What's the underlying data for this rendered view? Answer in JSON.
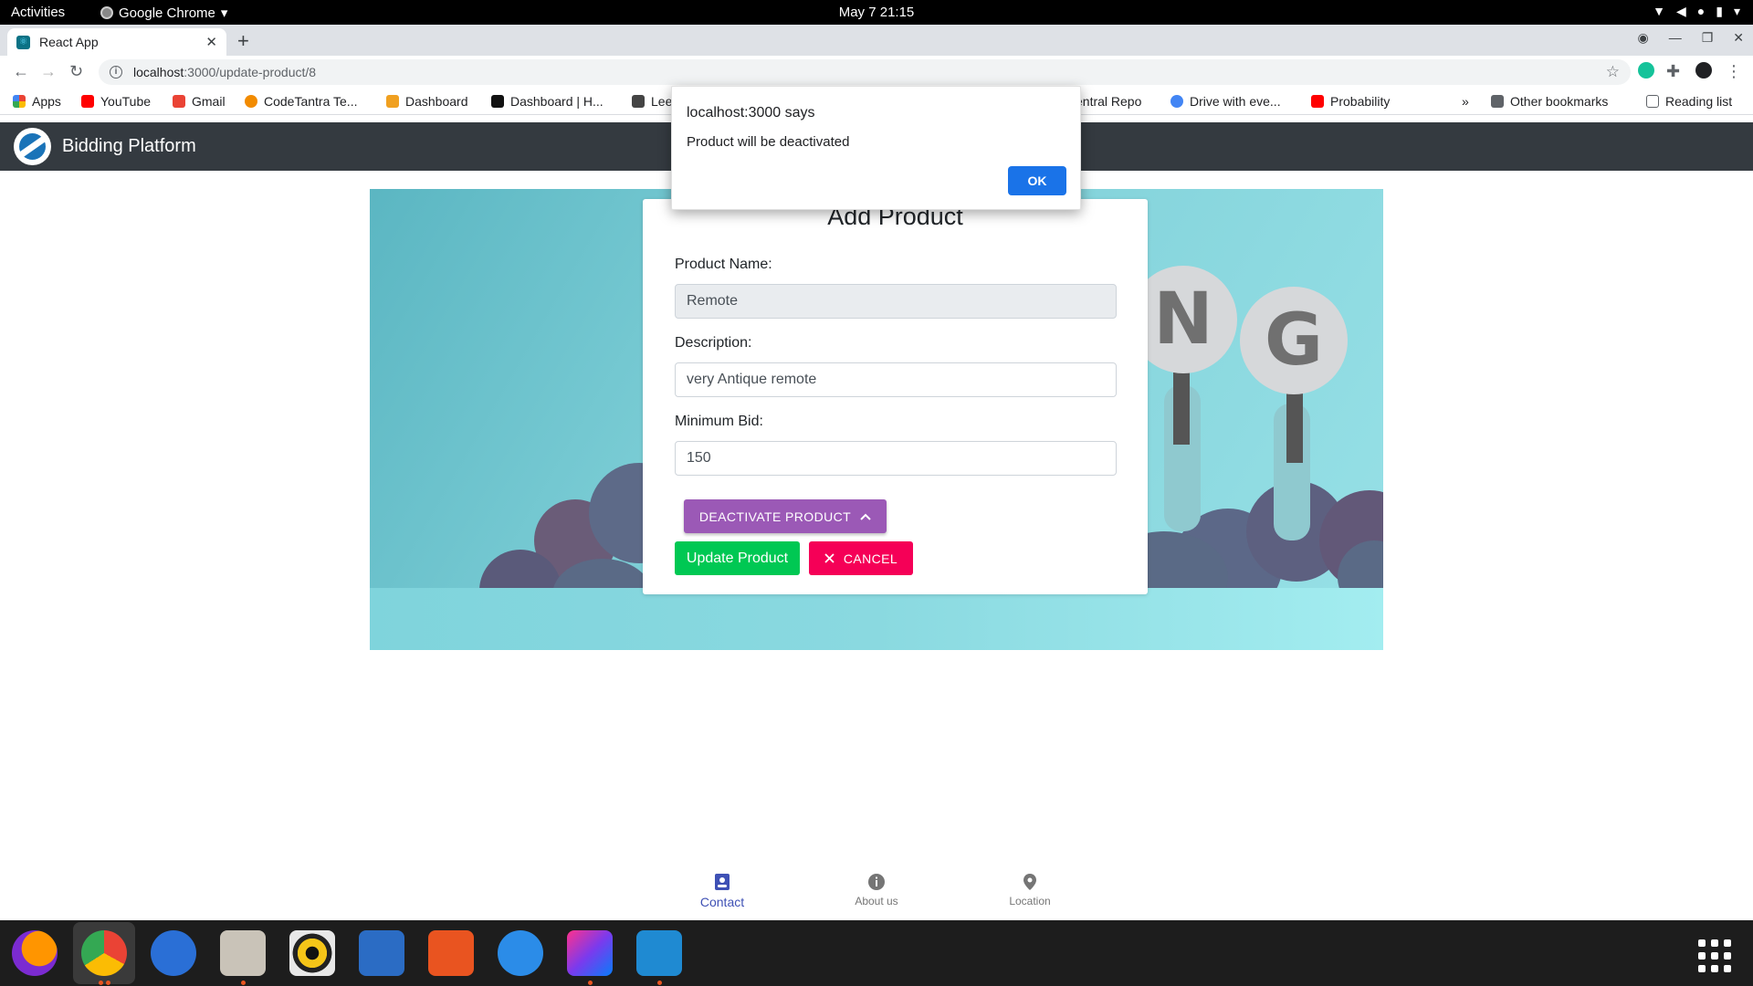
{
  "system": {
    "activities": "Activities",
    "app_menu": "Google Chrome",
    "clock": "May 7  21:15"
  },
  "browser": {
    "tab_title": "React App",
    "url_host": "localhost",
    "url_path": ":3000/update-product/8",
    "bookmarks": [
      {
        "label": "Apps"
      },
      {
        "label": "YouTube"
      },
      {
        "label": "Gmail"
      },
      {
        "label": "CodeTantra Te..."
      },
      {
        "label": "Dashboard"
      },
      {
        "label": "Dashboard | H..."
      },
      {
        "label": "Lee"
      },
      {
        "label": "entral Repo"
      },
      {
        "label": "Drive with eve..."
      },
      {
        "label": "Probability"
      },
      {
        "label": "»"
      },
      {
        "label": "Other bookmarks"
      },
      {
        "label": "Reading list"
      }
    ]
  },
  "header": {
    "brand": "Bidding Platform"
  },
  "hero": {
    "sign_left": "N",
    "sign_right": "G"
  },
  "form": {
    "title": "Add Product",
    "product_name_label": "Product Name:",
    "product_name_value": "Remote",
    "description_label": "Description:",
    "description_value": "very Antique remote",
    "min_bid_label": "Minimum Bid:",
    "min_bid_value": "150",
    "deactivate_label": "DEACTIVATE PRODUCT",
    "update_label": "Update Product",
    "cancel_label": "CANCEL"
  },
  "alert": {
    "title": "localhost:3000 says",
    "message": "Product will be deactivated",
    "ok_label": "OK"
  },
  "bottom_nav": {
    "items": [
      {
        "label": "Contact"
      },
      {
        "label": "About us"
      },
      {
        "label": "Location"
      }
    ]
  },
  "colors": {
    "header_bg": "#343a40",
    "deactivate": "#9b59b6",
    "update": "#00c853",
    "cancel": "#f50057",
    "alert_ok": "#1a73e8",
    "nav_active": "#3f51b5"
  }
}
